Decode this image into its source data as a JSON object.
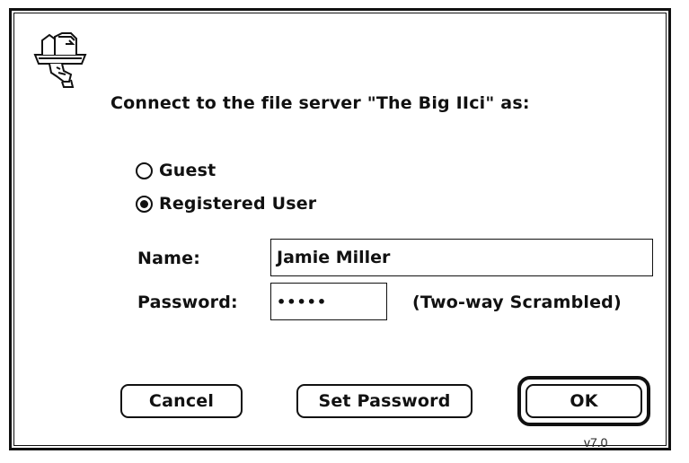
{
  "dialog": {
    "icon": "file-server-icon",
    "prompt": "Connect to the file server \"The Big IIci\" as:",
    "options": {
      "guest_label": "Guest",
      "registered_label": "Registered User",
      "selected": "Registered User"
    },
    "name_label": "Name:",
    "name_value": "Jamie Miller",
    "password_label": "Password:",
    "password_value": "•••••",
    "scramble_note": "(Two-way Scrambled)",
    "buttons": {
      "cancel": "Cancel",
      "set_password": "Set Password",
      "ok": "OK"
    },
    "version": "v7.0"
  },
  "colors": {
    "foreground": "#111111",
    "background": "#ffffff"
  }
}
